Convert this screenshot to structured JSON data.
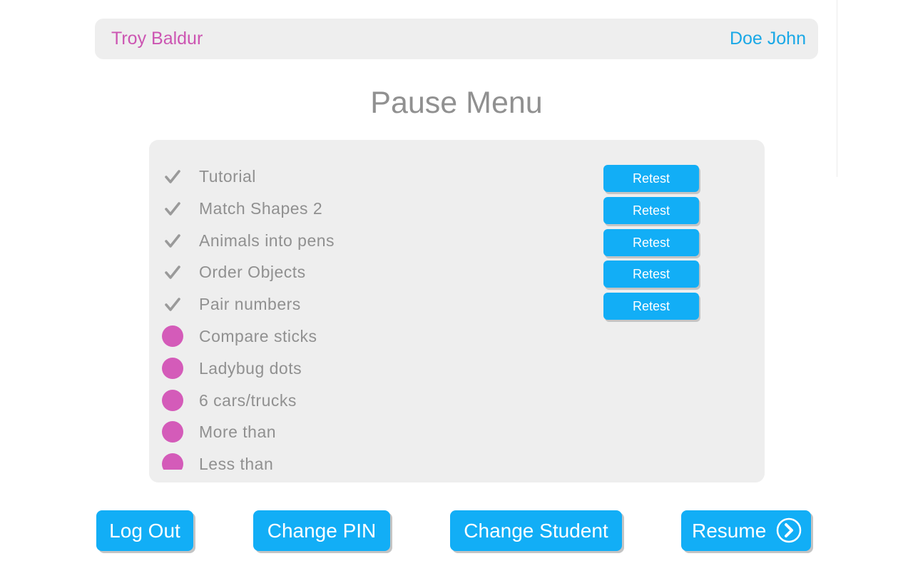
{
  "header": {
    "teacher_name": "Troy Baldur",
    "student_name": "Doe John"
  },
  "title": "Pause Menu",
  "activities": [
    {
      "label": "Tutorial",
      "status": "completed",
      "icon": "checkmark-icon",
      "action": "Retest"
    },
    {
      "label": "Match Shapes 2",
      "status": "completed",
      "icon": "checkmark-icon",
      "action": "Retest"
    },
    {
      "label": "Animals into pens",
      "status": "completed",
      "icon": "checkmark-icon",
      "action": "Retest"
    },
    {
      "label": "Order Objects",
      "status": "completed",
      "icon": "checkmark-icon",
      "action": "Retest"
    },
    {
      "label": "Pair numbers",
      "status": "completed",
      "icon": "checkmark-icon",
      "action": "Retest"
    },
    {
      "label": "Compare sticks",
      "status": "pending",
      "icon": "pending-dot-icon"
    },
    {
      "label": "Ladybug dots",
      "status": "pending",
      "icon": "pending-dot-icon"
    },
    {
      "label": "6 cars/trucks",
      "status": "pending",
      "icon": "pending-dot-icon"
    },
    {
      "label": "More than",
      "status": "pending",
      "icon": "pending-dot-icon"
    },
    {
      "label": "Less than",
      "status": "pending",
      "icon": "pending-dot-icon"
    }
  ],
  "footer": {
    "logout_label": "Log Out",
    "change_pin_label": "Change PIN",
    "change_student_label": "Change Student",
    "resume_label": "Resume",
    "resume_icon": "chevron-right-circle-icon"
  },
  "colors": {
    "accent": "#12aef6",
    "teacher_name": "#cc55b2",
    "student_name": "#1aa8e6",
    "pending_dot": "#d45bb9",
    "text_gray": "#909090",
    "panel_bg": "#eeeeee"
  }
}
